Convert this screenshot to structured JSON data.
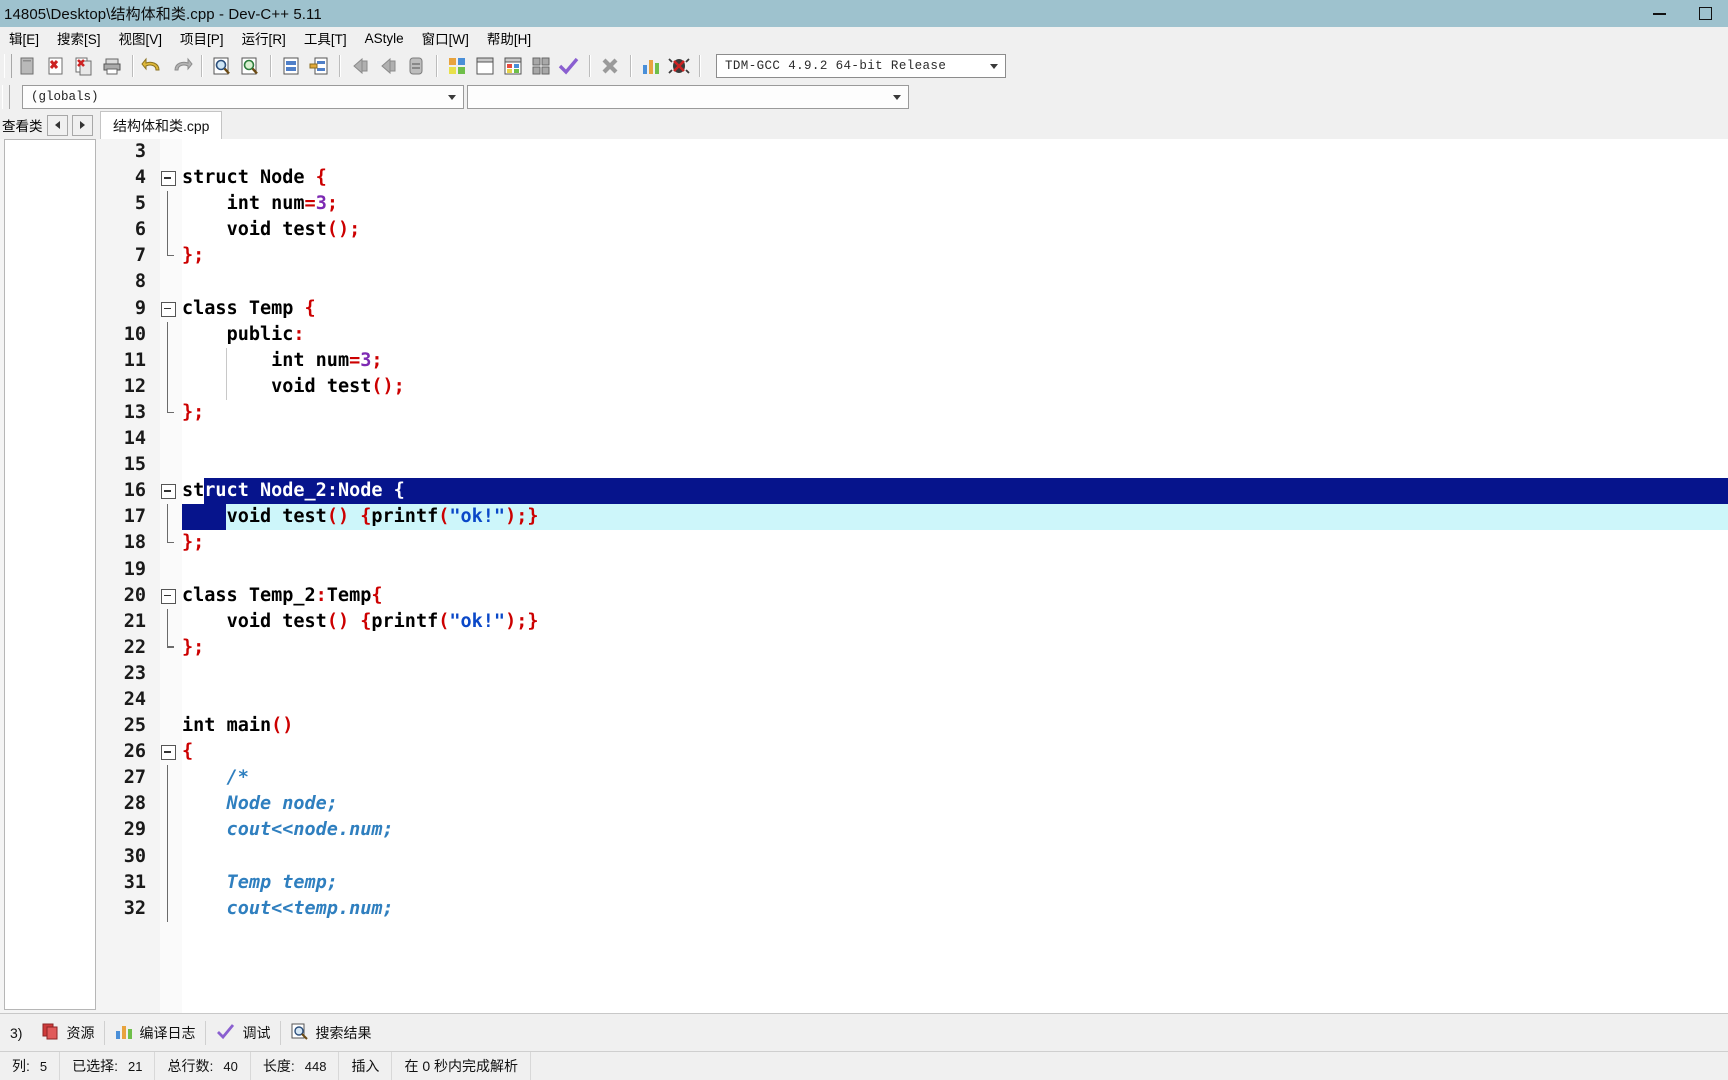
{
  "window": {
    "title": "14805\\Desktop\\结构体和类.cpp - Dev-C++ 5.11",
    "minimize_label": "",
    "maximize_label": ""
  },
  "menubar": {
    "items": [
      {
        "label": "辑[E]"
      },
      {
        "label": "搜索[S]"
      },
      {
        "label": "视图[V]"
      },
      {
        "label": "项目[P]"
      },
      {
        "label": "运行[R]"
      },
      {
        "label": "工具[T]"
      },
      {
        "label": "AStyle"
      },
      {
        "label": "窗口[W]"
      },
      {
        "label": "帮助[H]"
      }
    ]
  },
  "toolbar": {
    "icons": [
      "new-file-icon",
      "close-file-icon",
      "close-all-icon",
      "print-icon",
      "undo-icon",
      "redo-icon",
      "find-icon",
      "find-next-icon",
      "goto-line-icon",
      "goto-function-icon",
      "back-icon",
      "forward-icon",
      "properties-icon",
      "compile-icon",
      "run-icon",
      "compile-run-icon",
      "rebuild-all-icon",
      "syntax-check-icon",
      "stop-icon",
      "profile-icon",
      "debug-icon"
    ],
    "compiler_value": "TDM-GCC 4.9.2 64-bit Release",
    "globals_value": "(globals)",
    "class_value": ""
  },
  "left_panel": {
    "title": "查看类",
    "nav_prev": "prev-icon",
    "nav_next": "next-icon"
  },
  "editor": {
    "tab_label": "结构体和类.cpp",
    "first_visible_line": 3,
    "lines": [
      {
        "n": 3,
        "tokens": []
      },
      {
        "n": 4,
        "fold": "start",
        "tokens": [
          {
            "t": "struct ",
            "c": "k"
          },
          {
            "t": "Node ",
            "c": "id"
          },
          {
            "t": "{",
            "c": "p"
          }
        ]
      },
      {
        "n": 5,
        "fold": "mid",
        "tokens": [
          {
            "t": "    ",
            "c": "id"
          },
          {
            "t": "int ",
            "c": "k"
          },
          {
            "t": "num",
            "c": "id"
          },
          {
            "t": "=",
            "c": "p"
          },
          {
            "t": "3",
            "c": "n"
          },
          {
            "t": ";",
            "c": "p"
          }
        ]
      },
      {
        "n": 6,
        "fold": "mid",
        "tokens": [
          {
            "t": "    ",
            "c": "id"
          },
          {
            "t": "void ",
            "c": "k"
          },
          {
            "t": "test",
            "c": "id"
          },
          {
            "t": "();",
            "c": "p"
          }
        ]
      },
      {
        "n": 7,
        "fold": "end",
        "tokens": [
          {
            "t": "};",
            "c": "p"
          }
        ]
      },
      {
        "n": 8,
        "tokens": []
      },
      {
        "n": 9,
        "fold": "start",
        "tokens": [
          {
            "t": "class ",
            "c": "k"
          },
          {
            "t": "Temp ",
            "c": "id"
          },
          {
            "t": "{",
            "c": "p"
          }
        ]
      },
      {
        "n": 10,
        "fold": "mid",
        "tokens": [
          {
            "t": "    ",
            "c": "id"
          },
          {
            "t": "public",
            "c": "k"
          },
          {
            "t": ":",
            "c": "p"
          }
        ]
      },
      {
        "n": 11,
        "fold": "mid",
        "guide": 1,
        "tokens": [
          {
            "t": "        ",
            "c": "id"
          },
          {
            "t": "int ",
            "c": "k"
          },
          {
            "t": "num",
            "c": "id"
          },
          {
            "t": "=",
            "c": "p"
          },
          {
            "t": "3",
            "c": "n"
          },
          {
            "t": ";",
            "c": "p"
          }
        ]
      },
      {
        "n": 12,
        "fold": "mid",
        "guide": 1,
        "tokens": [
          {
            "t": "        ",
            "c": "id"
          },
          {
            "t": "void ",
            "c": "k"
          },
          {
            "t": "test",
            "c": "id"
          },
          {
            "t": "();",
            "c": "p"
          }
        ]
      },
      {
        "n": 13,
        "fold": "end",
        "tokens": [
          {
            "t": "};",
            "c": "p"
          }
        ]
      },
      {
        "n": 14,
        "tokens": []
      },
      {
        "n": 15,
        "tokens": []
      },
      {
        "n": 16,
        "fold": "start",
        "selection": "full-from-2",
        "tokens": [
          {
            "t": "st",
            "c": "k"
          },
          {
            "t": "ruct ",
            "c": "selwhite"
          },
          {
            "t": "Node_2",
            "c": "selwhite"
          },
          {
            "t": ":",
            "c": "selwhite"
          },
          {
            "t": "Node ",
            "c": "selwhite"
          },
          {
            "t": "{",
            "c": "selwhite"
          }
        ]
      },
      {
        "n": 17,
        "fold": "mid",
        "current": true,
        "selection": "indent-4",
        "tokens": [
          {
            "t": "    ",
            "c": "id"
          },
          {
            "t": "void ",
            "c": "k"
          },
          {
            "t": "test",
            "c": "id"
          },
          {
            "t": "() {",
            "c": "p"
          },
          {
            "t": "printf",
            "c": "id"
          },
          {
            "t": "(",
            "c": "p"
          },
          {
            "t": "\"ok!\"",
            "c": "s"
          },
          {
            "t": ");}",
            "c": "p"
          }
        ]
      },
      {
        "n": 18,
        "fold": "end",
        "tokens": [
          {
            "t": "};",
            "c": "p"
          }
        ]
      },
      {
        "n": 19,
        "tokens": []
      },
      {
        "n": 20,
        "fold": "start",
        "tokens": [
          {
            "t": "class ",
            "c": "k"
          },
          {
            "t": "Temp_2",
            "c": "id"
          },
          {
            "t": ":",
            "c": "p"
          },
          {
            "t": "Temp",
            "c": "id"
          },
          {
            "t": "{",
            "c": "p"
          }
        ]
      },
      {
        "n": 21,
        "fold": "mid",
        "tokens": [
          {
            "t": "    ",
            "c": "id"
          },
          {
            "t": "void ",
            "c": "k"
          },
          {
            "t": "test",
            "c": "id"
          },
          {
            "t": "() {",
            "c": "p"
          },
          {
            "t": "printf",
            "c": "id"
          },
          {
            "t": "(",
            "c": "p"
          },
          {
            "t": "\"ok!\"",
            "c": "s"
          },
          {
            "t": ");}",
            "c": "p"
          }
        ]
      },
      {
        "n": 22,
        "fold": "end",
        "tokens": [
          {
            "t": "};",
            "c": "p"
          }
        ]
      },
      {
        "n": 23,
        "tokens": []
      },
      {
        "n": 24,
        "tokens": []
      },
      {
        "n": 25,
        "tokens": [
          {
            "t": "int ",
            "c": "k"
          },
          {
            "t": "main",
            "c": "id"
          },
          {
            "t": "()",
            "c": "p"
          }
        ]
      },
      {
        "n": 26,
        "fold": "start",
        "tokens": [
          {
            "t": "{",
            "c": "p"
          }
        ]
      },
      {
        "n": 27,
        "fold": "mid",
        "tokens": [
          {
            "t": "    /*",
            "c": "cm"
          }
        ]
      },
      {
        "n": 28,
        "fold": "mid",
        "tokens": [
          {
            "t": "    Node node;",
            "c": "cm"
          }
        ]
      },
      {
        "n": 29,
        "fold": "mid",
        "tokens": [
          {
            "t": "    cout<<node.num;",
            "c": "cm"
          }
        ]
      },
      {
        "n": 30,
        "fold": "mid",
        "tokens": []
      },
      {
        "n": 31,
        "fold": "mid",
        "tokens": [
          {
            "t": "    Temp temp;",
            "c": "cm"
          }
        ]
      },
      {
        "n": 32,
        "fold": "mid",
        "tokens": [
          {
            "t": "    cout<<temp.num;",
            "c": "cm"
          }
        ]
      }
    ]
  },
  "bottom_tabs": [
    {
      "label": "3)",
      "icon": ""
    },
    {
      "label": "资源",
      "icon": "resources-icon"
    },
    {
      "label": "编译日志",
      "icon": "compile-log-icon"
    },
    {
      "label": "调试",
      "icon": "debug-check-icon"
    },
    {
      "label": "搜索结果",
      "icon": "search-results-icon"
    }
  ],
  "statusbar": [
    {
      "label": "列:",
      "value": "5"
    },
    {
      "label": "已选择:",
      "value": "21"
    },
    {
      "label": "总行数:",
      "value": "40"
    },
    {
      "label": "长度:",
      "value": "448"
    },
    {
      "label": "插入",
      "value": ""
    },
    {
      "label": "在 0 秒内完成解析",
      "value": ""
    }
  ],
  "colors": {
    "titlebar": "#9ec2ce",
    "chrome": "#f0f0f0",
    "selection": "#06148c",
    "current_line": "#cdf6fa",
    "keyword": "#000000",
    "punct": "#cc0000",
    "number": "#7d2ab3",
    "string": "#0a48c8",
    "comment": "#2f7fbf"
  }
}
